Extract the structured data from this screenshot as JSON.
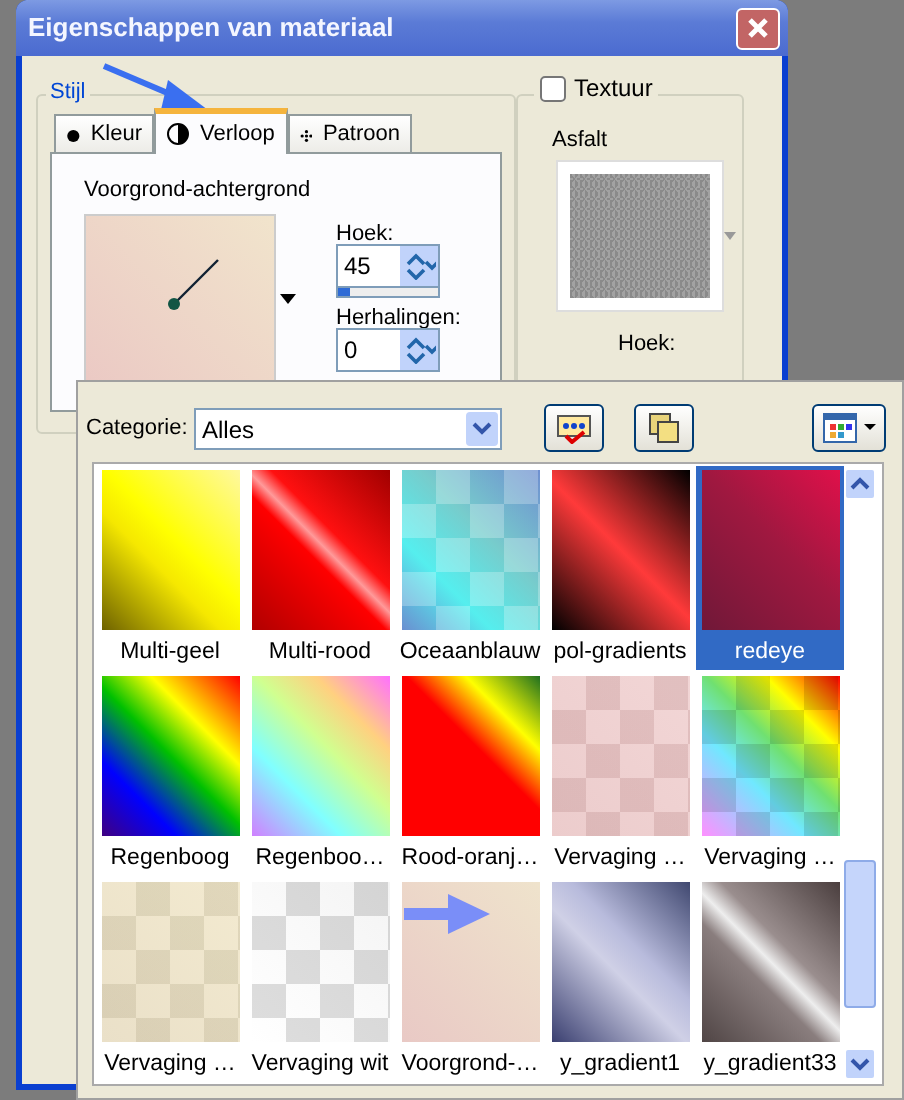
{
  "window": {
    "title": "Eigenschappen van materiaal"
  },
  "style_group": {
    "label": "Stijl",
    "tabs": [
      {
        "label": "Kleur",
        "selected": false
      },
      {
        "label": "Verloop",
        "selected": true
      },
      {
        "label": "Patroon",
        "selected": false
      }
    ],
    "gradient_name": "Voorgrond-achtergrond",
    "angle": {
      "label": "Hoek:",
      "value": "45",
      "level": 0.12
    },
    "repeats": {
      "label": "Herhalingen:",
      "value": "0"
    }
  },
  "texture_group": {
    "label": "Textuur",
    "checked": false,
    "name": "Asfalt",
    "angle_label": "Hoek:"
  },
  "picker": {
    "category_label": "Categorie:",
    "category": "Alles",
    "presets": [
      {
        "name": "Multi-geel",
        "selected": false
      },
      {
        "name": "Multi-rood",
        "selected": false
      },
      {
        "name": "Oceaanblauw",
        "selected": false
      },
      {
        "name": "pol-gradients",
        "selected": false
      },
      {
        "name": "redeye",
        "selected": true
      },
      {
        "name": "Regenboog",
        "selected": false
      },
      {
        "name": "Regenboo…",
        "selected": false
      },
      {
        "name": "Rood-oranj…",
        "selected": false
      },
      {
        "name": "Vervaging …",
        "selected": false
      },
      {
        "name": "Vervaging …",
        "selected": false
      },
      {
        "name": "Vervaging …",
        "selected": false
      },
      {
        "name": "Vervaging wit",
        "selected": false
      },
      {
        "name": "Voorgrond-…",
        "selected": false
      },
      {
        "name": "y_gradient1",
        "selected": false
      },
      {
        "name": "y_gradient33",
        "selected": false
      }
    ]
  }
}
